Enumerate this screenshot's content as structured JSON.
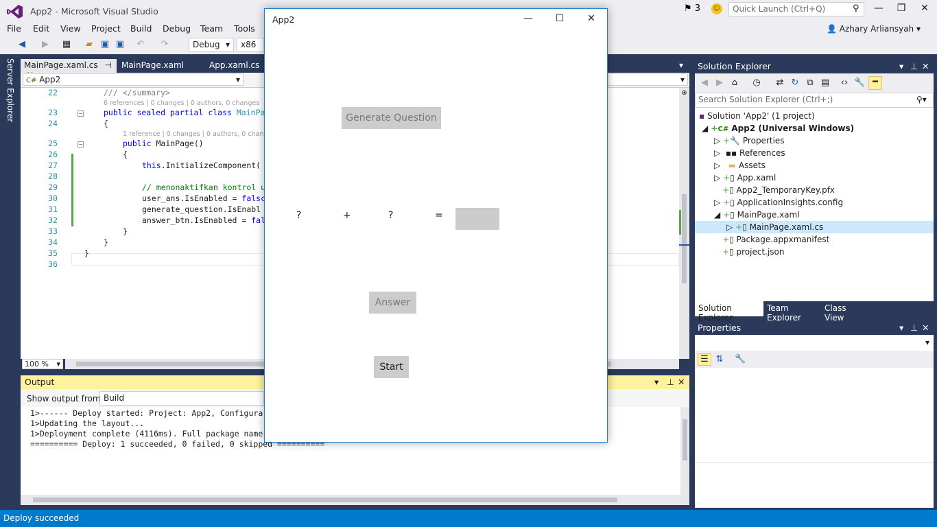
{
  "window": {
    "title": "App2 - Microsoft Visual Studio"
  },
  "notifications": {
    "count": "3"
  },
  "quick_launch": {
    "placeholder": "Quick Launch (Ctrl+Q)"
  },
  "user": {
    "name": "Azhary Arliansyah"
  },
  "menu": [
    "File",
    "Edit",
    "View",
    "Project",
    "Build",
    "Debug",
    "Team",
    "Tools"
  ],
  "toolbar": {
    "configuration": "Debug",
    "platform": "x86"
  },
  "side_tab": "Server Explorer",
  "doc_tabs": [
    {
      "label": "MainPage.xaml.cs",
      "pin": "⊣",
      "close": "✕",
      "active": true
    },
    {
      "label": "MainPage.xaml"
    },
    {
      "label": "App.xaml.cs"
    }
  ],
  "navbar": {
    "project": "App2"
  },
  "code": [
    {
      "num": "22",
      "text": "/// </summary>",
      "indent": 3,
      "class": "gr"
    },
    {
      "hint": "6 references | 0 changes | 0 authors, 0 changes",
      "indent": 3
    },
    {
      "num": "23",
      "kw": "public sealed partial class ",
      "ty": "MainPa",
      "indent": 3
    },
    {
      "num": "24",
      "text": "{",
      "indent": 3
    },
    {
      "hint": "1 reference | 0 changes | 0 authors, 0 chang",
      "indent": 7
    },
    {
      "num": "25",
      "kw": "public ",
      "text": "MainPage()",
      "indent": 7
    },
    {
      "num": "26",
      "text": "{",
      "indent": 7
    },
    {
      "num": "27",
      "kw": "this",
      "text": ".InitializeComponent(",
      "indent": 11
    },
    {
      "num": "28",
      "text": "",
      "indent": 0
    },
    {
      "num": "29",
      "text": "// menonaktifkan kontrol u",
      "indent": 11,
      "class": "cm"
    },
    {
      "num": "30",
      "text": "user_ans.IsEnabled = ",
      "kw2": "falsc",
      "indent": 11
    },
    {
      "num": "31",
      "text": "generate_question.IsEnabl",
      "indent": 11
    },
    {
      "num": "32",
      "text": "answer_btn.IsEnabled = ",
      "kw2": "fal",
      "indent": 11
    },
    {
      "num": "33",
      "text": "}",
      "indent": 7
    },
    {
      "num": "34",
      "text": "}",
      "indent": 3
    },
    {
      "num": "35",
      "text": "}",
      "indent": 0
    },
    {
      "num": "36",
      "text": "",
      "indent": 0
    }
  ],
  "zoom": "100 %",
  "output": {
    "title": "Output",
    "show_from_label": "Show output from:",
    "source": "Build",
    "lines": [
      "1>------ Deploy started: Project: App2, Configura",
      "1>Updating the layout...",
      "1>Deployment complete (4116ms). Full package name",
      "========== Deploy: 1 succeeded, 0 failed, 0 skipped =========="
    ]
  },
  "solution_explorer": {
    "title": "Solution Explorer",
    "search_placeholder": "Search Solution Explorer (Ctrl+;)",
    "nodes": [
      {
        "label": "Solution 'App2' (1 project)",
        "level": 0,
        "icon": "solution-icon"
      },
      {
        "label": "App2 (Universal Windows)",
        "level": 1,
        "bold": true,
        "icon": "csharp-project-icon"
      },
      {
        "label": "Properties",
        "level": 2,
        "icon": "wrench-icon"
      },
      {
        "label": "References",
        "level": 2,
        "icon": "references-icon"
      },
      {
        "label": "Assets",
        "level": 2,
        "icon": "folder-icon"
      },
      {
        "label": "App.xaml",
        "level": 2,
        "icon": "xaml-file-icon"
      },
      {
        "label": "App2_TemporaryKey.pfx",
        "level": 2,
        "icon": "key-file-icon"
      },
      {
        "label": "ApplicationInsights.config",
        "level": 2,
        "icon": "config-file-icon"
      },
      {
        "label": "MainPage.xaml",
        "level": 2,
        "icon": "xaml-file-icon"
      },
      {
        "label": "MainPage.xaml.cs",
        "level": 3,
        "selected": true,
        "icon": "cs-file-icon"
      },
      {
        "label": "Package.appxmanifest",
        "level": 2,
        "icon": "manifest-icon"
      },
      {
        "label": "project.json",
        "level": 2,
        "icon": "json-file-icon"
      }
    ],
    "tabs": [
      "Solution Explorer",
      "Team Explorer",
      "Class View"
    ]
  },
  "properties": {
    "title": "Properties"
  },
  "status": "Deploy succeeded",
  "app": {
    "title": "App2",
    "generate_label": "Generate Question",
    "operand1": "?",
    "operator": "+",
    "operand2": "?",
    "equals": "=",
    "answer_label": "Answer",
    "start_label": "Start"
  }
}
